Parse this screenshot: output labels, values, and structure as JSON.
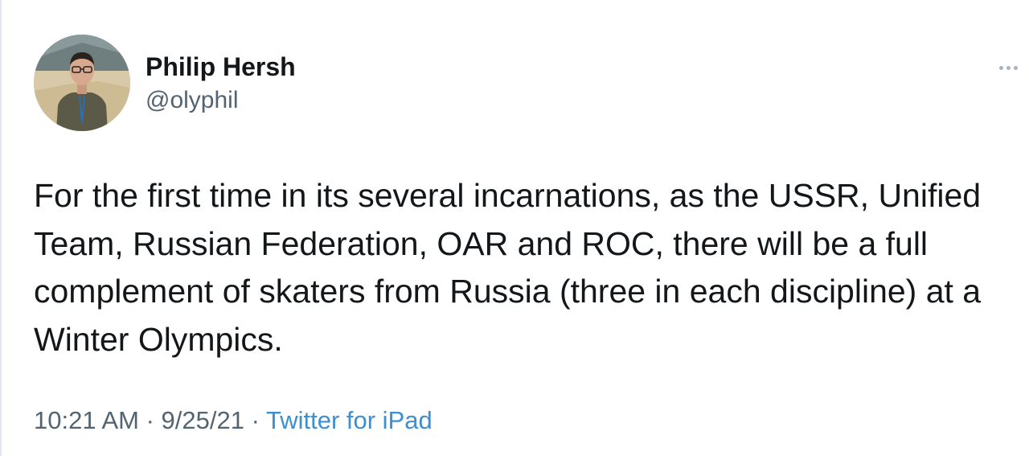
{
  "author": {
    "name": "Philip Hersh",
    "handle": "@olyphil"
  },
  "tweet": {
    "text": "For the first time in its several incarnations, as the USSR, Unified Team, Russian Federation, OAR and ROC, there will be a full complement of skaters from Russia (three in each discipline) at a Winter Olympics."
  },
  "meta": {
    "time": "10:21 AM",
    "separator": " · ",
    "date": "9/25/21",
    "source": "Twitter for iPad"
  },
  "icons": {
    "more": "more-options-icon"
  },
  "colors": {
    "text": "#14171a",
    "secondary": "#536471",
    "link": "#3d8fd1"
  }
}
